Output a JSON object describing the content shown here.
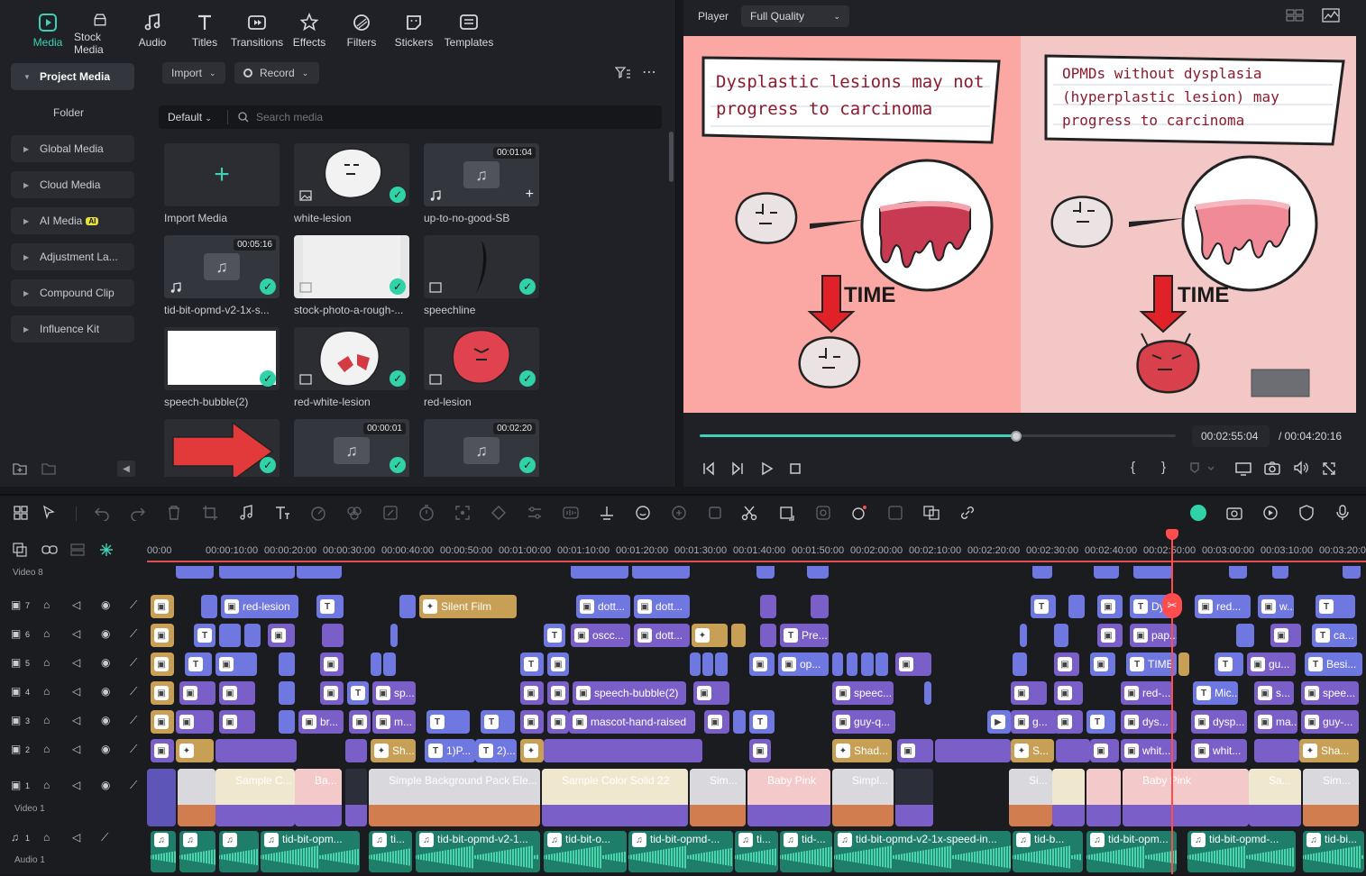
{
  "top_tabs": [
    {
      "label": "Media",
      "icon": "media-icon",
      "active": true
    },
    {
      "label": "Stock Media",
      "icon": "stock-media-icon"
    },
    {
      "label": "Audio",
      "icon": "audio-note-icon"
    },
    {
      "label": "Titles",
      "icon": "titles-t-icon"
    },
    {
      "label": "Transitions",
      "icon": "transitions-icon"
    },
    {
      "label": "Effects",
      "icon": "effects-icon"
    },
    {
      "label": "Filters",
      "icon": "filters-icon"
    },
    {
      "label": "Stickers",
      "icon": "stickers-icon"
    },
    {
      "label": "Templates",
      "icon": "templates-icon"
    }
  ],
  "sidebar": {
    "items": [
      {
        "label": "Project Media",
        "active": true
      },
      {
        "label": "Folder"
      },
      {
        "label": "Global Media"
      },
      {
        "label": "Cloud Media"
      },
      {
        "label": "AI Media",
        "badge": "AI"
      },
      {
        "label": "Adjustment La..."
      },
      {
        "label": "Compound Clip"
      },
      {
        "label": "Influence Kit"
      }
    ]
  },
  "media_toolbar": {
    "import_label": "Import",
    "record_label": "Record",
    "sort_label": "Default",
    "search_placeholder": "Search media"
  },
  "media_items": [
    {
      "label": "Import Media",
      "kind": "import"
    },
    {
      "label": "white-lesion",
      "kind": "image",
      "checked": true
    },
    {
      "label": "up-to-no-good-SB",
      "kind": "audio",
      "duration": "00:01:04",
      "checked": false
    },
    {
      "label": "tid-bit-opmd-v2-1x-s...",
      "kind": "audio",
      "duration": "00:05:16",
      "checked": true
    },
    {
      "label": "stock-photo-a-rough-...",
      "kind": "image",
      "checked": true
    },
    {
      "label": "speechline",
      "kind": "image",
      "checked": true
    },
    {
      "label": "speech-bubble(2)",
      "kind": "image",
      "checked": true
    },
    {
      "label": "red-white-lesion",
      "kind": "image",
      "checked": true
    },
    {
      "label": "red-lesion",
      "kind": "image",
      "checked": true
    },
    {
      "label": "",
      "kind": "image",
      "checked": true
    },
    {
      "label": "",
      "kind": "audio",
      "duration": "00:00:01",
      "checked": true
    },
    {
      "label": "",
      "kind": "audio",
      "duration": "00:02:20",
      "checked": true
    }
  ],
  "player": {
    "label": "Player",
    "quality": "Full Quality",
    "current_time": "00:02:55:04",
    "total_time": "/ 00:04:20:16",
    "progress": 0.665,
    "preview": {
      "left_note_line1": "Dysplastic lesions may not",
      "left_note_line2": "progress to carcinoma",
      "right_note_line1": "OPMDs without dysplasia",
      "right_note_line2": "(hyperplastic lesion) may",
      "right_note_line3": "progress to carcinoma",
      "time_label_left": "TIME",
      "time_label_right": "TIME"
    }
  },
  "timeline": {
    "ruler_ticks": [
      "00:00",
      "00:00:10:00",
      "00:00:20:00",
      "00:00:30:00",
      "00:00:40:00",
      "00:00:50:00",
      "00:01:00:00",
      "00:01:10:00",
      "00:01:20:00",
      "00:01:30:00",
      "00:01:40:00",
      "00:01:50:00",
      "00:02:00:00",
      "00:02:10:00",
      "00:02:20:00",
      "00:02:30:00",
      "00:02:40:00",
      "00:02:50:00",
      "00:03:00:00",
      "00:03:10:00",
      "00:03:20:00"
    ],
    "tracks": [
      {
        "id": "8",
        "label": "Video 8"
      },
      {
        "id": "7",
        "label": ""
      },
      {
        "id": "6",
        "label": ""
      },
      {
        "id": "5",
        "label": ""
      },
      {
        "id": "4",
        "label": ""
      },
      {
        "id": "3",
        "label": ""
      },
      {
        "id": "2",
        "label": ""
      },
      {
        "id": "1",
        "label": "Video 1"
      },
      {
        "id": "A1",
        "label": "Audio 1"
      }
    ],
    "clip_labels": {
      "t7": [
        "red-lesion",
        "Silent Film",
        "dott...",
        "dott...",
        "Dys",
        "red...",
        "w...",
        "T"
      ],
      "t6": [
        "oscc...",
        "dott...",
        "Pre...",
        "pap...",
        "ca..."
      ],
      "t5": [
        "op...",
        "TIME",
        "gu...",
        "Besi..."
      ],
      "t4": [
        "sp...",
        "speech-bubble(2)",
        "speec...",
        "red-...",
        "Mic...",
        "s...",
        "spee..."
      ],
      "t3": [
        "br...",
        "m...",
        "mascot-hand-raised",
        "guy-q...",
        "g...",
        "dys...",
        "dysp...",
        "ma...",
        "guy-..."
      ],
      "t2": [
        "Sh...",
        "1)P...",
        "2)...",
        "Shad...",
        "S...",
        "whit...",
        "whit...",
        "Sha..."
      ],
      "t1": [
        "Sample C...",
        "Ba...",
        "Simple Background Pack Ele...",
        "Sample Color Solid 22",
        "Sim...",
        "Baby Pink",
        "Simpl...",
        "Si...",
        "Baby Pink",
        "Sa...",
        "Sim..."
      ],
      "a1": [
        "tid-bit-opm...",
        "ti...",
        "tid-bit-opmd-v2-1...",
        "tid-bit-o...",
        "tid-bit-opmd-...",
        "ti...",
        "tid-...",
        "tid-bit-opmd-v2-1x-speed-in...",
        "tid-b...",
        "tid-bit-opm...",
        "tid-bit-opmd-...",
        "tid-bi..."
      ]
    }
  },
  "colors": {
    "accent": "#3fd0b5",
    "playhead": "#ff4d4d",
    "clip_blue": "#6f78e0",
    "clip_gold": "#c8a055",
    "audio_wave": "#2bb391"
  }
}
